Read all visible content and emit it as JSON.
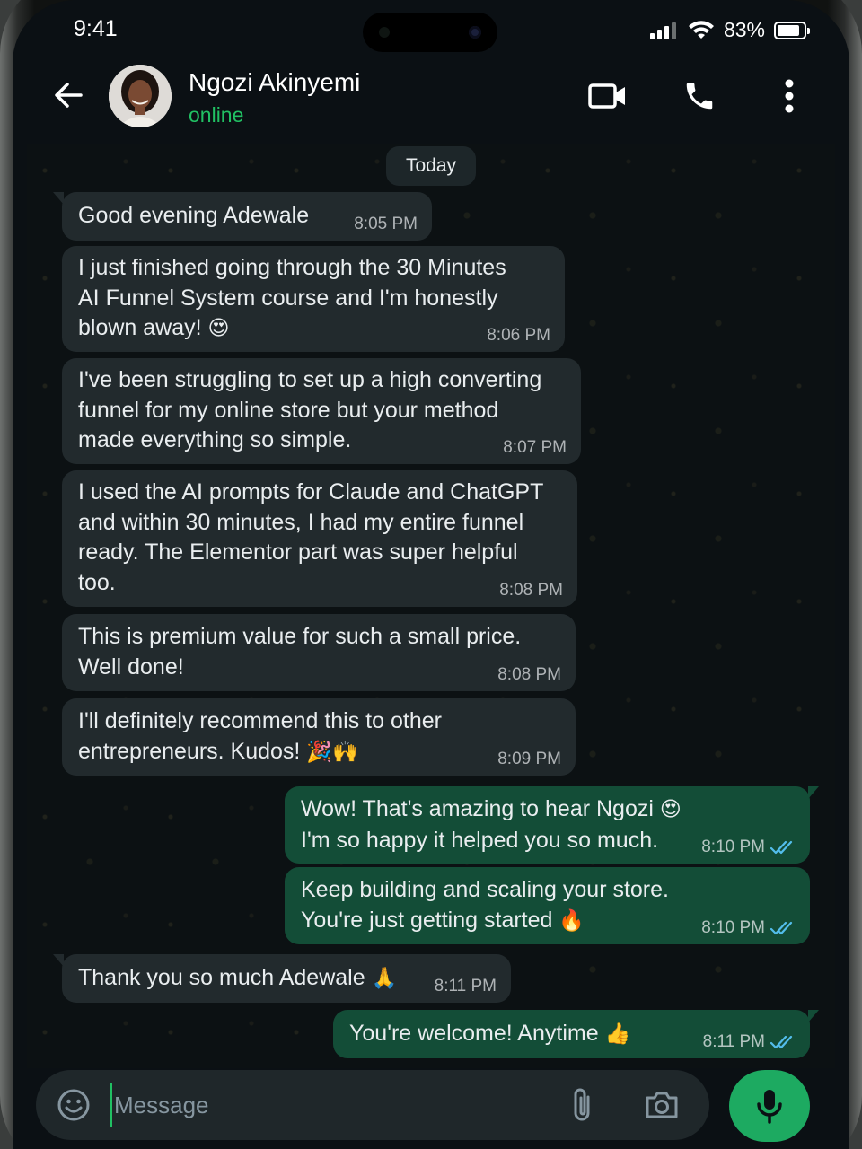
{
  "status_bar": {
    "time": "9:41",
    "battery_percent": "83%"
  },
  "header": {
    "contact_name": "Ngozi Akinyemi",
    "contact_status": "online",
    "icons": [
      "back-arrow-icon",
      "video-call-icon",
      "phone-icon",
      "more-vert-icon"
    ]
  },
  "date_chip": "Today",
  "messages": [
    {
      "direction": "incoming",
      "text": "Good evening Adewale",
      "time": "8:05 PM"
    },
    {
      "direction": "incoming",
      "lines": [
        "I just finished going through the 30 Minutes",
        "AI Funnel System course and I'm honestly",
        "blown away!"
      ],
      "emoji": "😍",
      "time": "8:06 PM"
    },
    {
      "direction": "incoming",
      "lines": [
        "I've been struggling to set up a high converting",
        "funnel for my online store but your method",
        "made everything so simple."
      ],
      "time": "8:07 PM"
    },
    {
      "direction": "incoming",
      "lines": [
        "I used the AI prompts for Claude and ChatGPT",
        "and within 30 minutes, I had my entire funnel",
        "ready. The Elementor part was super helpful",
        "too."
      ],
      "time": "8:08 PM"
    },
    {
      "direction": "incoming",
      "lines": [
        "This is premium value for such a small price.",
        "Well done!"
      ],
      "time": "8:08 PM"
    },
    {
      "direction": "incoming",
      "lines": [
        "I'll definitely recommend this to other",
        "entrepreneurs. Kudos!"
      ],
      "emoji": "🎉🙌",
      "time": "8:09 PM"
    },
    {
      "direction": "outgoing",
      "lines": [
        "Wow! That's amazing to hear Ngozi",
        "I'm so happy it helped you so much."
      ],
      "emoji": "😍",
      "time": "8:10 PM",
      "status": "read"
    },
    {
      "direction": "outgoing",
      "lines": [
        "Keep building and scaling your store.",
        "You're just getting started"
      ],
      "emoji": "🔥",
      "time": "8:10 PM",
      "status": "read"
    },
    {
      "direction": "incoming",
      "text": "Thank you so much Adewale",
      "emoji": "🙏",
      "time": "8:11 PM"
    },
    {
      "direction": "outgoing",
      "text": "You're welcome! Anytime",
      "emoji": "👍",
      "time": "8:11 PM",
      "status": "read"
    }
  ],
  "composer": {
    "placeholder": "Message",
    "icons": [
      "emoji-icon",
      "paperclip-icon",
      "camera-icon",
      "mic-icon"
    ]
  },
  "colors": {
    "accent_green": "#21c063",
    "incoming_bubble": "#222a2d",
    "outgoing_bubble": "#134d37",
    "read_tick": "#53bdeb",
    "mic_button": "#1daa61"
  }
}
